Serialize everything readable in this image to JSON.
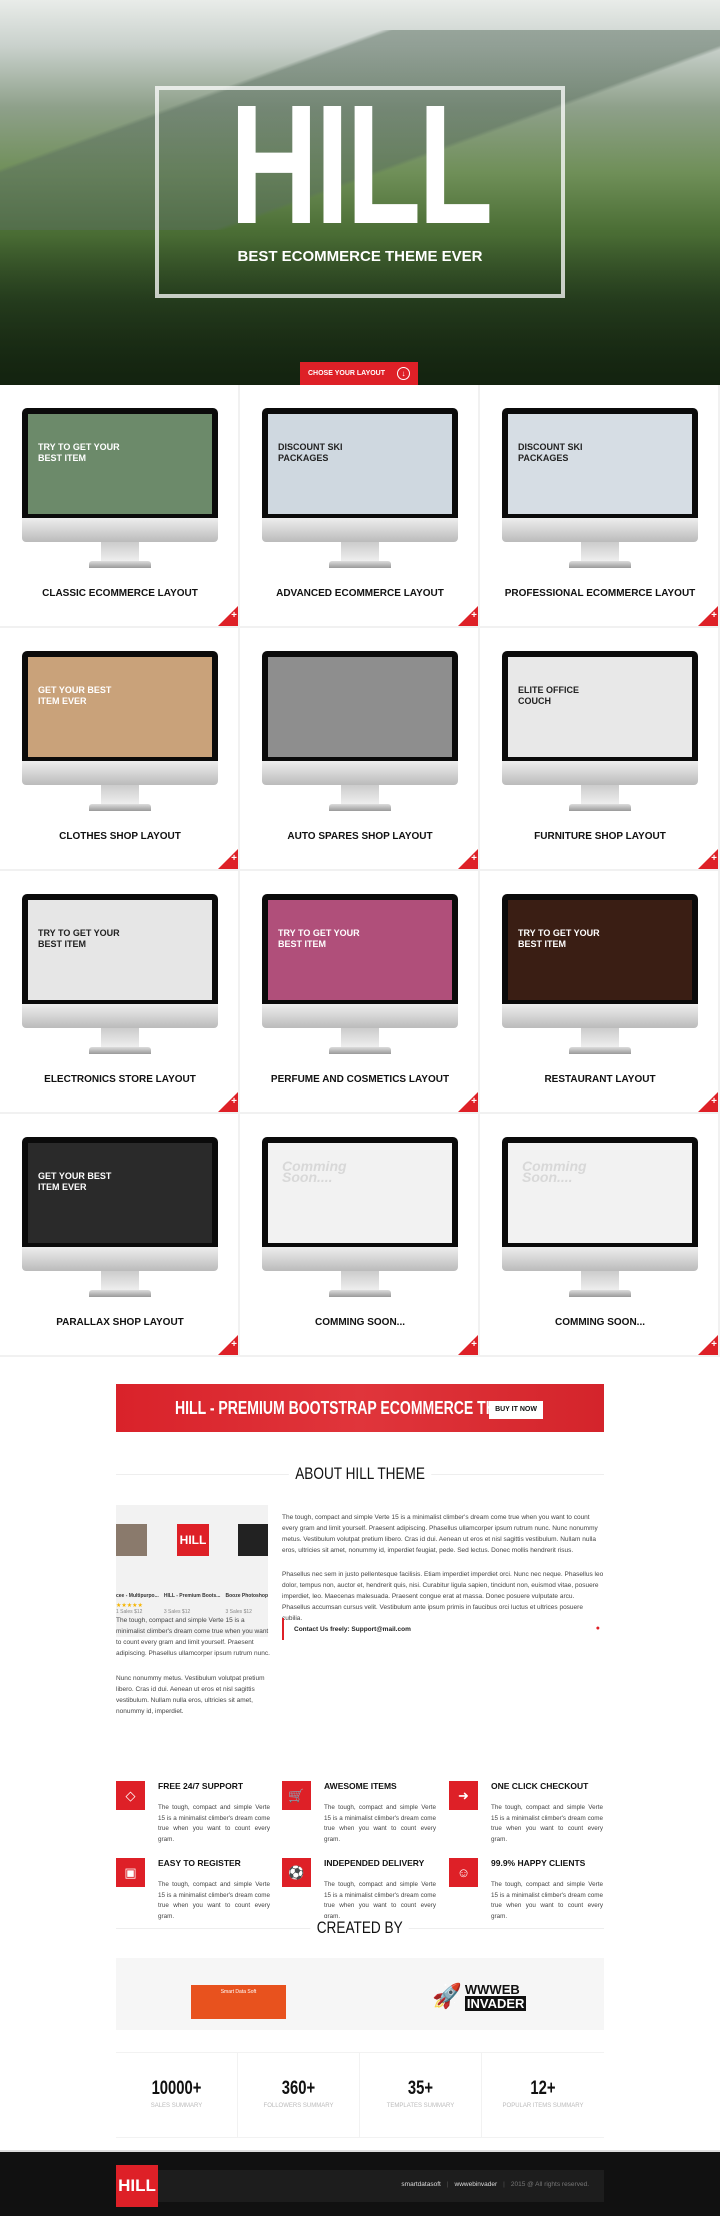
{
  "hero": {
    "title": "HILL",
    "subtitle": "BEST ECOMMERCE THEME EVER",
    "cta_label": "CHOSE YOUR LAYOUT",
    "cta_icon": "arrow-down-circle-icon"
  },
  "layouts": [
    {
      "title": "CLASSIC ECOMMERCE LAYOUT",
      "preview": "TRY TO GET YOUR BEST ITEM",
      "bg": "#6c8a6a"
    },
    {
      "title": "ADVANCED ECOMMERCE LAYOUT",
      "preview": "DISCOUNT SKI PACKAGES",
      "bg": "#cfd8e0"
    },
    {
      "title": "PROFESSIONAL ECOMMERCE LAYOUT",
      "preview": "DISCOUNT SKI PACKAGES",
      "bg": "#d6dde4"
    },
    {
      "title": "CLOTHES SHOP LAYOUT",
      "preview": "GET YOUR BEST ITEM EVER",
      "bg": "#c9a27a"
    },
    {
      "title": "AUTO SPARES SHOP LAYOUT",
      "preview": "",
      "bg": "#8e8e8e"
    },
    {
      "title": "FURNITURE SHOP LAYOUT",
      "preview": "ELITE OFFICE COUCH",
      "bg": "#e8e8e8"
    },
    {
      "title": "ELECTRONICS STORE LAYOUT",
      "preview": "TRY TO GET YOUR BEST ITEM",
      "bg": "#e6e6e6"
    },
    {
      "title": "PERFUME AND COSMETICS LAYOUT",
      "preview": "TRY TO GET YOUR BEST ITEM",
      "bg": "#b04f7a"
    },
    {
      "title": "RESTAURANT LAYOUT",
      "preview": "TRY TO GET YOUR BEST ITEM",
      "bg": "#3a1e14"
    },
    {
      "title": "PARALLAX SHOP LAYOUT",
      "preview": "GET YOUR BEST ITEM EVER",
      "bg": "#2a2a2a"
    },
    {
      "title": "COMMING SOON...",
      "preview": "Comming Soon....",
      "bg": "#f2f2f2"
    },
    {
      "title": "COMMING SOON...",
      "preview": "Comming Soon....",
      "bg": "#f2f2f2"
    }
  ],
  "banner": {
    "title": "HILL - PREMIUM BOOTSTRAP ECOMMERCE THEME",
    "button": "BUY IT NOW"
  },
  "about": {
    "title": "ABOUT HILL THEME",
    "products": [
      {
        "name": "cee - Multipurpo...",
        "sales": "1 Sales",
        "price": "$12"
      },
      {
        "name": "HILL - Premium Boots...",
        "sales": "3 Sales",
        "price": "$12"
      },
      {
        "name": "Booze Photoshop",
        "sales": "3 Sales",
        "price": "$12"
      }
    ],
    "product_logo": "HILL",
    "para1": "The tough, compact and simple Verte 15 is a minimalist climber's dream come true when you want to count every gram and limit yourself. Praesent adipiscing. Phasellus ullamcorper ipsum rutrum nunc. Nunc nonummy metus. Vestibulum volutpat pretium libero. Cras id dui. Aenean ut eros et nisl sagittis vestibulum. Nullam nulla eros, ultricies sit amet, nonummy id, imperdiet feugiat, pede. Sed lectus. Donec mollis hendrerit risus.",
    "para2": "Phasellus nec sem in justo pellentesque facilisis. Etiam imperdiet imperdiet orci. Nunc nec neque. Phasellus leo dolor, tempus non, auctor et, hendrerit quis, nisi. Curabitur ligula sapien, tincidunt non, euismod vitae, posuere imperdiet, leo. Maecenas malesuada. Praesent congue erat at massa. Donec posuere vulputate arcu. Phasellus accumsan cursus velit. Vestibulum ante ipsum primis in faucibus orci luctus et ultrices posuere cubilia.",
    "left1": "The tough, compact and simple Verte 15 is a minimalist climber's dream come true when you want to count every gram and limit yourself. Praesent adipiscing. Phasellus ullamcorper ipsum rutrum nunc.",
    "left2": "Nunc nonummy metus. Vestibulum volutpat pretium libero. Cras id dui. Aenean ut eros et nisl sagittis vestibulum. Nullam nulla eros, ultricies sit amet, nonummy id, imperdiet.",
    "contact": "Contact Us freely: Support@mail.com"
  },
  "features": [
    {
      "title": "FREE 24/7 SUPPORT",
      "icon": "diamond-icon",
      "glyph": "◇",
      "text": "The tough, compact and simple Verte 15 is a minimalist climber's dream come true when you want to count every gram."
    },
    {
      "title": "AWESOME ITEMS",
      "icon": "cart-icon",
      "glyph": "🛒",
      "text": "The tough, compact and simple Verte 15 is a minimalist climber's dream come true when you want to count every gram."
    },
    {
      "title": "ONE CLICK CHECKOUT",
      "icon": "sign-in-icon",
      "glyph": "➜",
      "text": "The tough, compact and simple Verte 15 is a minimalist climber's dream come true when you want to count every gram."
    },
    {
      "title": "EASY TO REGISTER",
      "icon": "bus-icon",
      "glyph": "▣",
      "text": "The tough, compact and simple Verte 15 is a minimalist climber's dream come true when you want to count every gram."
    },
    {
      "title": "INDEPENDED DELIVERY",
      "icon": "soccer-ball-icon",
      "glyph": "⚽",
      "text": "The tough, compact and simple Verte 15 is a minimalist climber's dream come true when you want to count every gram."
    },
    {
      "title": "99.9% HAPPY CLIENTS",
      "icon": "smile-icon",
      "glyph": "☺",
      "text": "The tough, compact and simple Verte 15 is a minimalist climber's dream come true when you want to count every gram."
    }
  ],
  "created": {
    "title": "CREATED BY",
    "logo1": "Smart Data Soft",
    "logo2_line1": "WWWEB",
    "logo2_line2": "INVADER"
  },
  "stats": [
    {
      "value": "10000+",
      "label": "SALES SUMMARY"
    },
    {
      "value": "360+",
      "label": "FOLLOWERS SUMMARY"
    },
    {
      "value": "35+",
      "label": "TEMPLATES SUMMARY"
    },
    {
      "value": "12+",
      "label": "POPULAR ITEMS SUMMARY"
    }
  ],
  "footer": {
    "logo": "HILL",
    "link1": "smartdatasoft",
    "link2": "wwwebinvader",
    "copyright": "2015 @ All rights reserved."
  },
  "colors": {
    "accent": "#de2027",
    "footer_bg": "#111111"
  }
}
